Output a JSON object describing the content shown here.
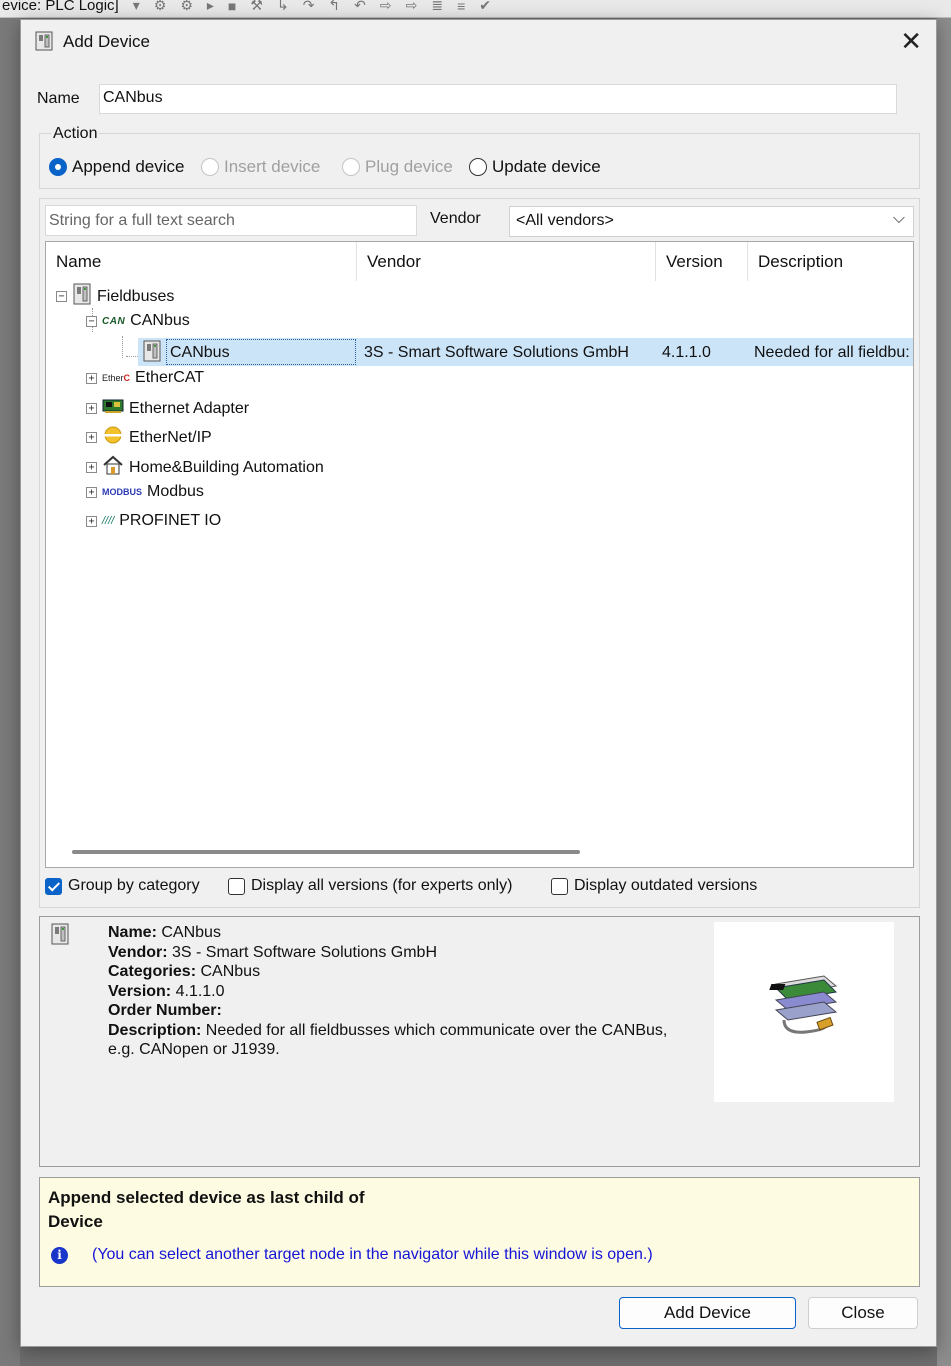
{
  "background_app": {
    "title": "evice: PLC Logic]",
    "toolbar_icons": [
      "dropdown-arrow",
      "gear-run",
      "gear",
      "play",
      "stop",
      "build-hammer",
      "step-into",
      "step-over",
      "step-out",
      "step-back",
      "go-to",
      "toggle-breakpoint",
      "watch",
      "filter",
      "check"
    ]
  },
  "dialog": {
    "title": "Add Device",
    "name_label": "Name",
    "name_value": "CANbus",
    "action": {
      "label": "Action",
      "options": [
        "Append device",
        "Insert device",
        "Plug device",
        "Update device"
      ],
      "selected": "Append device"
    },
    "search_placeholder": "String for a full text search",
    "vendor_label": "Vendor",
    "vendor_value": "<All vendors>",
    "columns": [
      "Name",
      "Vendor",
      "Version",
      "Description"
    ],
    "tree": {
      "root": "Fieldbuses",
      "canbus_category": "CANbus",
      "selected_device": {
        "name": "CANbus",
        "vendor": "3S - Smart Software Solutions GmbH",
        "version": "4.1.1.0",
        "description": "Needed for all fieldbu:"
      },
      "categories": [
        "EtherCAT",
        "Ethernet Adapter",
        "EtherNet/IP",
        "Home&Building Automation",
        "Modbus",
        "PROFINET IO"
      ]
    },
    "options": {
      "group_by_category": "Group by category",
      "group_by_category_checked": true,
      "display_all_versions": "Display all versions (for experts only)",
      "display_outdated": "Display outdated versions"
    },
    "details": {
      "name_label": "Name:",
      "name": "CANbus",
      "vendor_label": "Vendor:",
      "vendor": "3S - Smart Software Solutions GmbH",
      "categories_label": "Categories:",
      "categories": "CANbus",
      "version_label": "Version:",
      "version": "4.1.1.0",
      "order_label": "Order Number:",
      "order": "",
      "description_label": "Description:",
      "description_line1": "Needed for all fieldbusses which communicate over the CANBus,",
      "description_line2": "e.g. CANopen or J1939."
    },
    "info": {
      "message_line1": "Append selected device as last child of",
      "message_line2": "Device",
      "hint": "(You can select another target node in the navigator while this window is open.)"
    },
    "buttons": {
      "add": "Add Device",
      "close": "Close"
    },
    "colors": {
      "accent": "#0a63c9",
      "selection": "#cce4f7",
      "info_bg": "#fdfbe2",
      "hint_text": "#1515d6"
    }
  }
}
